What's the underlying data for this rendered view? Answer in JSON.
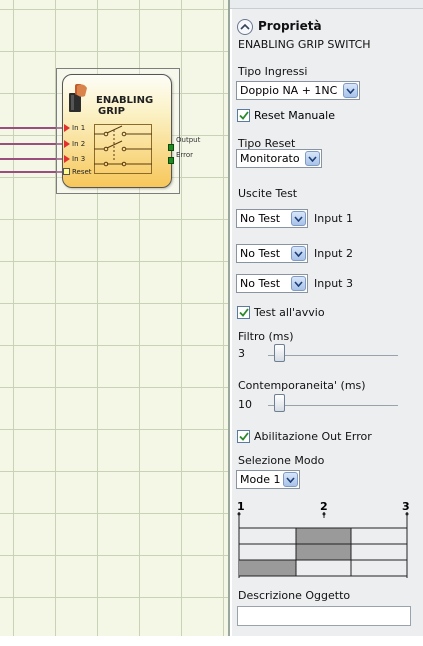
{
  "canvas": {
    "block": {
      "title_line1": "ENABLING",
      "title_line2": "GRIP",
      "inputs": [
        "In 1",
        "In 2",
        "In 3"
      ],
      "reset_label": "Reset",
      "outputs": [
        "Output",
        "Error"
      ]
    }
  },
  "panel": {
    "header": "Proprietà",
    "subtitle": "ENABLING GRIP SWITCH",
    "tipo_ingressi": {
      "label": "Tipo Ingressi",
      "value": "Doppio NA + 1NC"
    },
    "reset_manuale": {
      "label": "Reset Manuale",
      "checked": true
    },
    "tipo_reset": {
      "label": "Tipo Reset",
      "value": "Monitorato"
    },
    "uscite_test": {
      "label": "Uscite Test",
      "rows": [
        {
          "value": "No Test",
          "input_label": "Input 1"
        },
        {
          "value": "No Test",
          "input_label": "Input 2"
        },
        {
          "value": "No Test",
          "input_label": "Input 3"
        }
      ]
    },
    "test_avvio": {
      "label": "Test all'avvio",
      "checked": true
    },
    "filtro": {
      "label": "Filtro (ms)",
      "value": "3"
    },
    "contemporaneita": {
      "label": "Contemporaneita' (ms)",
      "value": "10"
    },
    "abilitazione_out_error": {
      "label": "Abilitazione Out Error",
      "checked": true
    },
    "selezione_modo": {
      "label": "Selezione Modo",
      "value": "Mode 1"
    },
    "mode_table": {
      "columns": [
        "1",
        "2",
        "3"
      ],
      "rows": [
        [
          false,
          true,
          false
        ],
        [
          false,
          true,
          false
        ],
        [
          true,
          false,
          false
        ]
      ]
    },
    "descrizione_oggetto": {
      "label": "Descrizione Oggetto",
      "value": ""
    }
  },
  "colors": {
    "canvas_bg": "#f4f6e6",
    "panel_bg": "#eceef0",
    "block_gradient_bottom": "#f7c75a",
    "output_green": "#1f8a1f",
    "input_arrow_red": "#e03030",
    "mode_cell_active": "#9a9a9a"
  },
  "icons": [
    "collapse-up-icon",
    "dropdown-arrow-icon",
    "checkmark-icon",
    "hand-grip-icon",
    "switch-symbol-icon"
  ]
}
